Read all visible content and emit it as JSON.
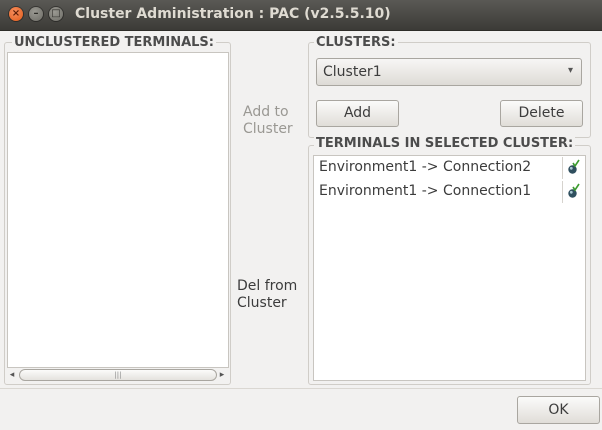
{
  "window": {
    "title": "Cluster Administration : PAC (v2.5.5.10)",
    "controls": {
      "close": "×",
      "minimize": "–",
      "maximize": "□"
    }
  },
  "unclustered": {
    "label": "UNCLUSTERED TERMINALS:",
    "items": [],
    "scrollbar": {
      "left_arrow": "◂",
      "right_arrow": "▸",
      "grip": "|||"
    }
  },
  "actions": {
    "add_to_cluster": "Add to\nCluster",
    "del_from_cluster": "Del from\nCluster"
  },
  "clusters": {
    "label": "CLUSTERS:",
    "selected": "Cluster1",
    "dropdown_arrow": "▾",
    "add_label": "Add",
    "delete_label": "Delete"
  },
  "terminals": {
    "label": "TERMINALS IN SELECTED CLUSTER:",
    "items": [
      {
        "name": "Environment1 -> Connection2",
        "status_icon": "connected-status-icon"
      },
      {
        "name": "Environment1 -> Connection1",
        "status_icon": "connected-status-icon"
      }
    ]
  },
  "footer": {
    "ok_label": "OK"
  }
}
